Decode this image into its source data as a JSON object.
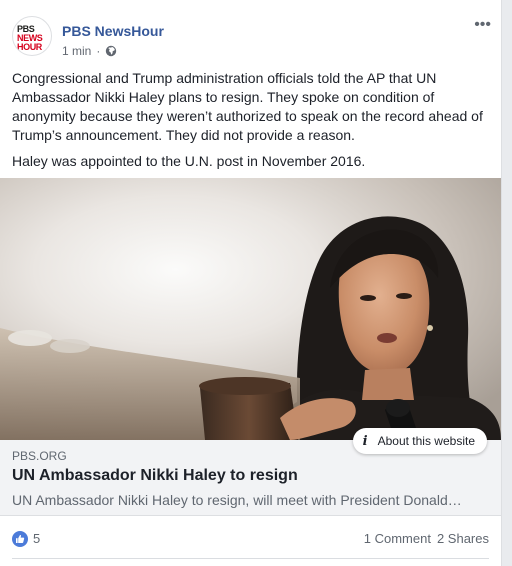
{
  "post": {
    "page_name": "PBS NewsHour",
    "avatar_logo": [
      "PBS",
      "NEWS",
      "HOUR"
    ],
    "time": "1 min",
    "privacy_icon": "globe-icon",
    "more_label": "•••",
    "paragraphs": [
      "Congressional and Trump administration officials told the AP that UN Ambassador Nikki Haley plans to resign. They spoke on condition of anonymity because they weren’t authorized to speak on the record ahead of Trump’s announcement. They did not provide a reason.",
      "Haley was appointed to the U.N. post in November 2016."
    ]
  },
  "link": {
    "domain": "PBS.ORG",
    "title": "UN Ambassador Nikki Haley to resign",
    "description": "UN Ambassador Nikki Haley to resign, will meet with President Donald…",
    "about_label": "About this website",
    "about_icon": "info-icon"
  },
  "reactions": {
    "like_count": "5",
    "comments": "1 Comment",
    "shares": "2 Shares"
  },
  "colors": {
    "link_blue": "#365899",
    "like_blue": "#4c7bd9",
    "pbs_red": "#d6001c"
  }
}
